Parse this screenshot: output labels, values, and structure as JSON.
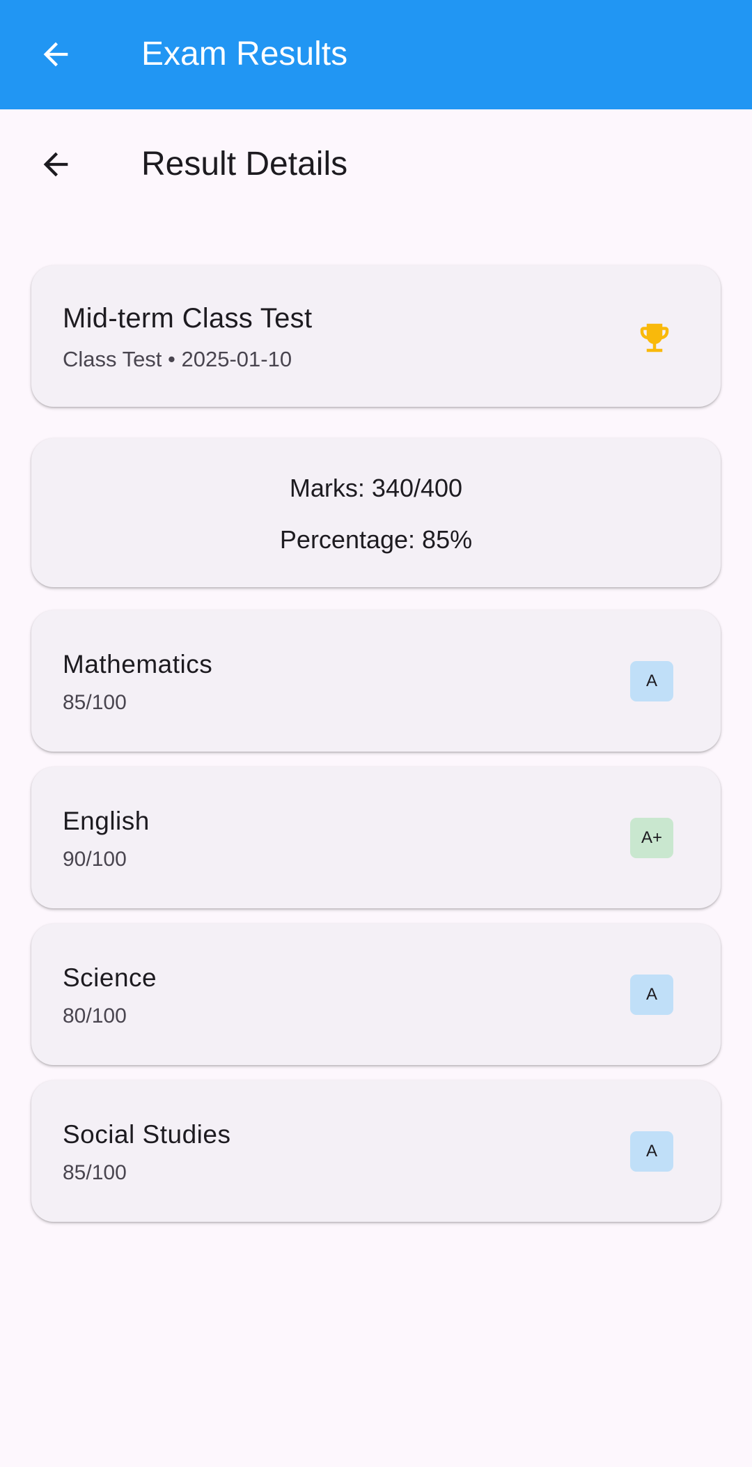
{
  "app_bar": {
    "title": "Exam Results",
    "back_icon": "arrow-back-icon",
    "color": "#2196f3"
  },
  "page_header": {
    "title": "Result Details",
    "back_icon": "arrow-back-icon"
  },
  "exam": {
    "name": "Mid-term Class Test",
    "meta": "Class Test • 2025-01-10",
    "icon": "trophy-icon",
    "icon_color": "#f9b90b"
  },
  "summary": {
    "marks": "Marks: 340/400",
    "percentage": "Percentage: 85%"
  },
  "subjects": [
    {
      "name": "Mathematics",
      "score": "85/100",
      "grade": "A",
      "grade_color": "#c0dff8"
    },
    {
      "name": "English",
      "score": "90/100",
      "grade": "A+",
      "grade_color": "#c9e7cf"
    },
    {
      "name": "Science",
      "score": "80/100",
      "grade": "A",
      "grade_color": "#c0dff8"
    },
    {
      "name": "Social Studies",
      "score": "85/100",
      "grade": "A",
      "grade_color": "#c0dff8"
    }
  ]
}
